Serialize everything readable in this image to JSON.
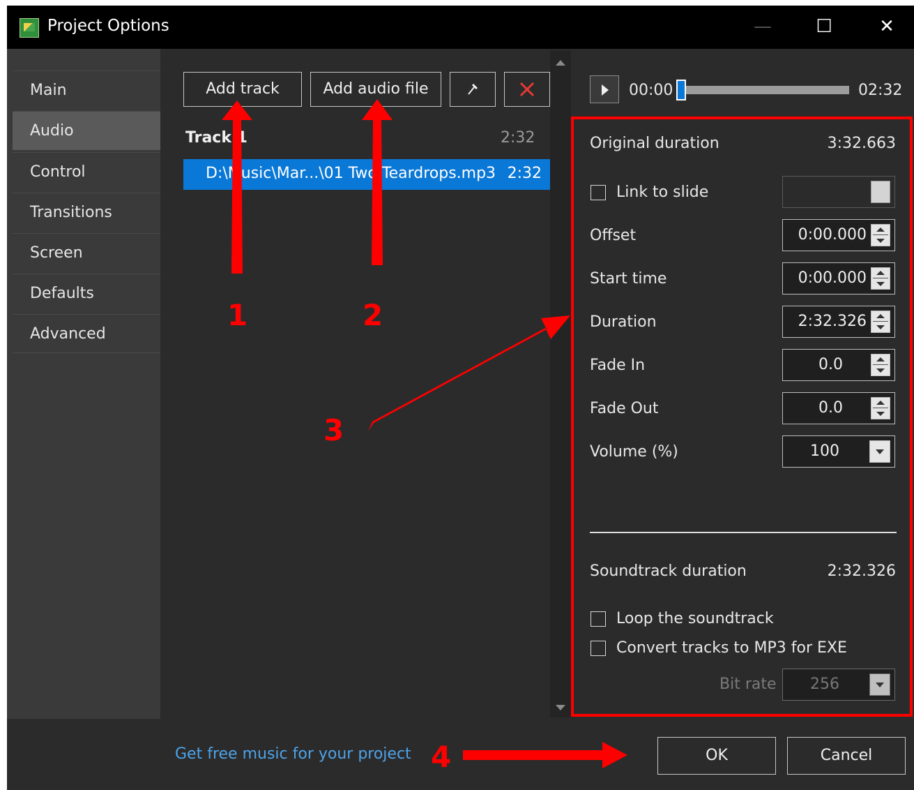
{
  "window": {
    "title": "Project Options",
    "minimize_glyph": "—",
    "maximize_glyph": "☐",
    "close_glyph": "✕"
  },
  "sidebar": {
    "items": [
      {
        "label": "Main"
      },
      {
        "label": "Audio",
        "active": true
      },
      {
        "label": "Control"
      },
      {
        "label": "Transitions"
      },
      {
        "label": "Screen"
      },
      {
        "label": "Defaults"
      },
      {
        "label": "Advanced"
      }
    ]
  },
  "toolbar": {
    "add_track_label": "Add track",
    "add_audio_file_label": "Add audio file",
    "edit_icon": "pin-icon",
    "delete_icon": "delete-icon"
  },
  "tracks": {
    "header": "Track 1",
    "header_duration": "2:32",
    "files": [
      {
        "path": "D:\\Music\\Mar...\\01 Two Teardrops.mp3",
        "duration": "2:32"
      }
    ]
  },
  "player": {
    "current_time": "00:00",
    "total_time": "02:32",
    "position": 0
  },
  "properties": {
    "original_duration_label": "Original duration",
    "original_duration_value": "3:32.663",
    "link_to_slide_label": "Link to slide",
    "link_to_slide_checked": false,
    "offset_label": "Offset",
    "offset_value": "0:00.000",
    "start_time_label": "Start time",
    "start_time_value": "0:00.000",
    "duration_label": "Duration",
    "duration_value": "2:32.326",
    "fade_in_label": "Fade In",
    "fade_in_value": "0.0",
    "fade_out_label": "Fade Out",
    "fade_out_value": "0.0",
    "volume_label": "Volume (%)",
    "volume_value": "100",
    "soundtrack_duration_label": "Soundtrack duration",
    "soundtrack_duration_value": "2:32.326",
    "loop_label": "Loop the soundtrack",
    "loop_checked": false,
    "convert_label": "Convert tracks to MP3 for EXE",
    "convert_checked": false,
    "bitrate_label": "Bit rate",
    "bitrate_value": "256"
  },
  "footer": {
    "free_music_link": "Get free music for your project",
    "ok_label": "OK",
    "cancel_label": "Cancel"
  },
  "annotations": {
    "numbers": [
      "1",
      "2",
      "3",
      "4"
    ],
    "color": "#ff0000"
  },
  "colors": {
    "accent": "#0a78d7",
    "link": "#4ea3e8",
    "panel": "#2b2b2b",
    "sidebar": "#3a3a3a"
  }
}
